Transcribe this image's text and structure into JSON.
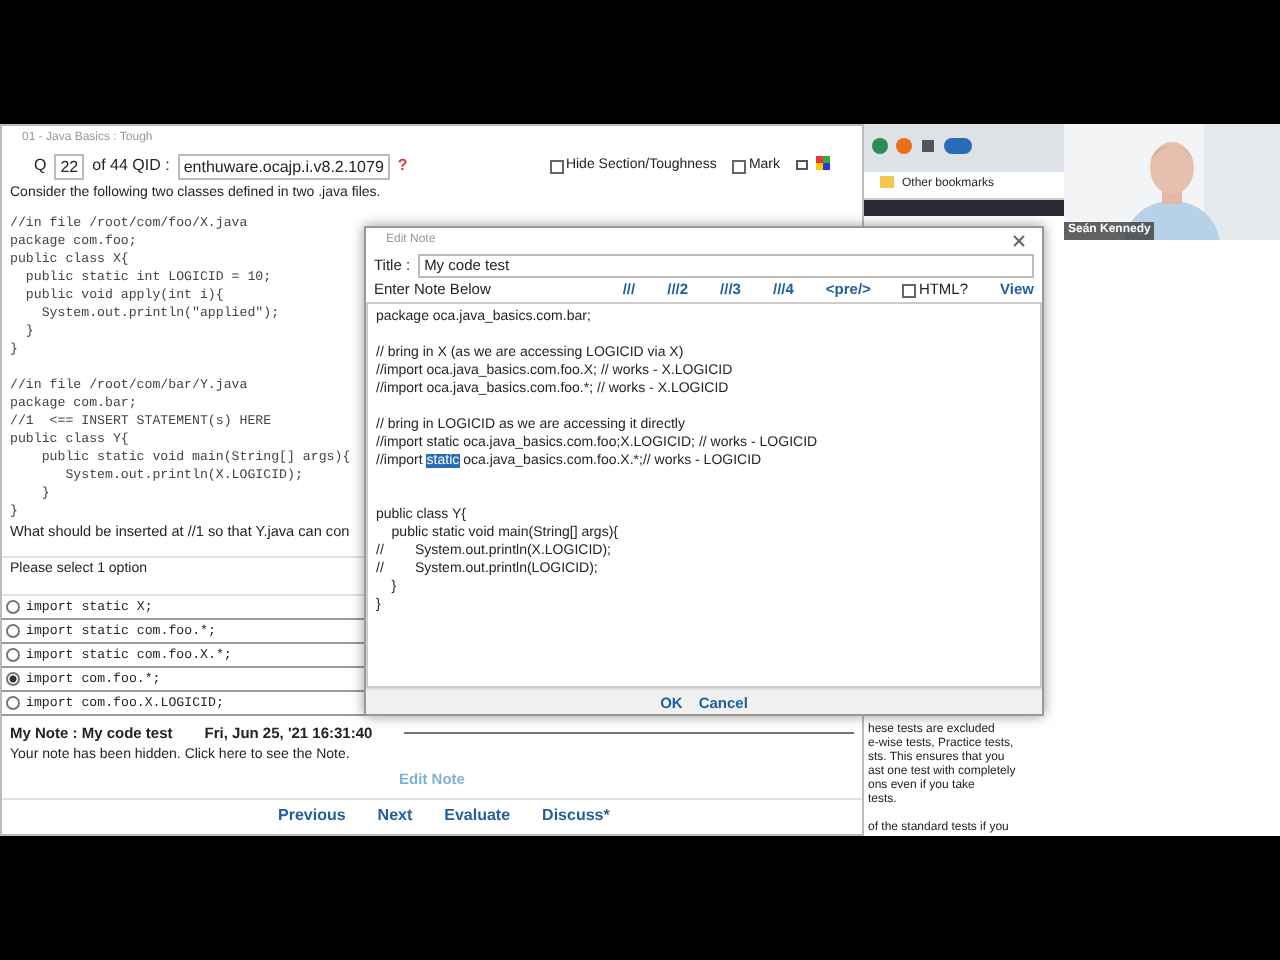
{
  "main_window": {
    "title": "01 - Java Basics : Tough",
    "question_label": "Q",
    "question_number": "22",
    "question_total": "of 44 QID :",
    "qid": "enthuware.ocajp.i.v8.2.1079",
    "help": "?",
    "options_bar": [
      {
        "label": "Hide Section/Toughness",
        "checked": false
      },
      {
        "label": "Mark",
        "checked": false
      }
    ],
    "prompt": "Consider the following two classes defined in two .java files.",
    "code_files": [
      [
        "//in file /root/com/foo/X.java",
        "package com.foo;",
        "public class X{",
        "  public static int LOGICID = 10;",
        "  public void apply(int i){",
        "    System.out.println(\"applied\");",
        "  }",
        "}"
      ],
      [
        "//in file /root/com/bar/Y.java",
        "package com.bar;",
        "//1  <== INSERT STATEMENT(s) HERE",
        "public class Y{",
        "    public static void main(String[] args){",
        "       System.out.println(X.LOGICID);",
        "    }",
        "}"
      ]
    ],
    "question": "What should be inserted at //1 so that Y.java can con",
    "instruction": "Please select 1 option",
    "answers": [
      {
        "text": "import static X;",
        "selected": false
      },
      {
        "text": "import static com.foo.*;",
        "selected": false
      },
      {
        "text": "import static com.foo.X.*;",
        "selected": false
      },
      {
        "text": "import com.foo.*;",
        "selected": true
      },
      {
        "text": "import com.foo.X.LOGICID;",
        "selected": false
      }
    ],
    "note_header": "My Note : My code test",
    "note_date": "Fri, Jun 25, '21  16:31:40",
    "note_hidden": "Your note has been hidden. Click here to see the Note.",
    "edit_note": "Edit Note",
    "nav": [
      "Previous",
      "Next",
      "Evaluate",
      "Discuss*"
    ]
  },
  "browser": {
    "bookmarks": "Other bookmarks",
    "side_text": [
      [
        "hese tests are excluded",
        "e-wise tests, Practice tests,",
        "sts. This ensures that you",
        "ast one test with completely",
        "ons even if you take",
        "tests."
      ],
      [
        "of the standard tests if you"
      ]
    ]
  },
  "webcam": {
    "name": "Seán Kennedy"
  },
  "dialog": {
    "title": "Edit Note",
    "title_label": "Title :",
    "title_value": "My code test",
    "note_label": "Enter Note Below",
    "tools": [
      "///",
      "///2",
      "///3",
      "///4",
      "<pre/>"
    ],
    "html_option": {
      "label": "HTML?",
      "checked": false
    },
    "view": "View",
    "paragraphs": [
      [
        [
          {
            "text": "package oca.java_basics.com.bar;",
            "selected": false
          }
        ]
      ],
      [
        [
          {
            "text": "// bring in X (as we are accessing LOGICID via X)",
            "selected": false
          }
        ],
        [
          {
            "text": "//import oca.java_basics.com.foo.X; // works - X.LOGICID",
            "selected": false
          }
        ],
        [
          {
            "text": "//import oca.java_basics.com.foo.*; // works - X.LOGICID",
            "selected": false
          }
        ]
      ],
      [
        [
          {
            "text": "// bring in LOGICID as we are accessing it directly",
            "selected": false
          }
        ],
        [
          {
            "text": "//import static oca.java_basics.com.foo;X.LOGICID; // works - LOGICID",
            "selected": false
          }
        ],
        [
          {
            "text": "//import ",
            "selected": false
          },
          {
            "text": "static",
            "selected": true
          },
          {
            "text": " oca.java_basics.com.foo.X.*;// works - LOGICID",
            "selected": false
          }
        ]
      ],
      [
        [
          {
            "text": "public class Y{",
            "selected": false
          }
        ],
        [
          {
            "text": "    public static void main(String[] args){",
            "selected": false
          }
        ],
        [
          {
            "text": "//        System.out.println(X.LOGICID);",
            "selected": false
          }
        ],
        [
          {
            "text": "//        System.out.println(LOGICID);",
            "selected": false
          }
        ],
        [
          {
            "text": "    }",
            "selected": false
          }
        ],
        [
          {
            "text": "}",
            "selected": false
          }
        ]
      ]
    ],
    "buttons": [
      "OK",
      "Cancel"
    ]
  }
}
